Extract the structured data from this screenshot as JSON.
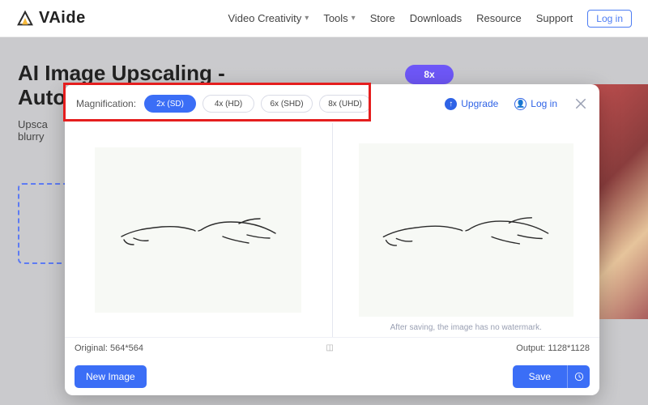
{
  "brand": "VAide",
  "nav": {
    "items": [
      {
        "label": "Video Creativity",
        "has_menu": true
      },
      {
        "label": "Tools",
        "has_menu": true
      },
      {
        "label": "Store",
        "has_menu": false
      },
      {
        "label": "Downloads",
        "has_menu": false
      },
      {
        "label": "Resource",
        "has_menu": false
      },
      {
        "label": "Support",
        "has_menu": false
      }
    ],
    "login_label": "Log in"
  },
  "bg": {
    "title": "AI Image Upscaling - Auto Enla",
    "subtitle_line1": "Upsca",
    "subtitle_line2": "blurry",
    "pill": "8x"
  },
  "modal": {
    "magnification_label": "Magnification:",
    "options": [
      {
        "label": "2x (SD)",
        "active": true
      },
      {
        "label": "4x (HD)",
        "active": false
      },
      {
        "label": "6x (SHD)",
        "active": false
      },
      {
        "label": "8x (UHD)",
        "active": false
      }
    ],
    "upgrade_label": "Upgrade",
    "login_label": "Log in",
    "watermark_note": "After saving, the image has no watermark.",
    "original_label": "Original: 564*564",
    "output_label": "Output: 1128*1128",
    "midglyph": "◫",
    "new_image_label": "New Image",
    "save_label": "Save"
  },
  "colors": {
    "accent": "#3b6ef6",
    "highlight": "#e51e1e"
  }
}
